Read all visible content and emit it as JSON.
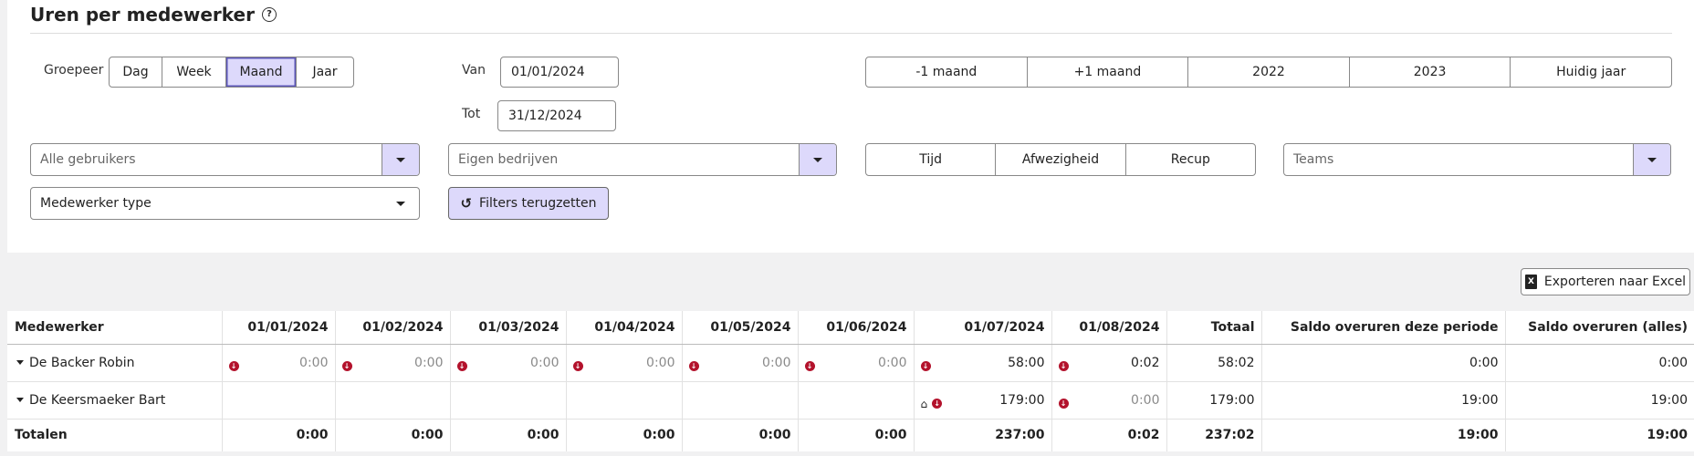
{
  "header": {
    "title": "Uren per medewerker"
  },
  "grouping": {
    "label": "Groepeer",
    "options": [
      "Dag",
      "Week",
      "Maand",
      "Jaar"
    ],
    "selected": "Maand"
  },
  "date_range": {
    "from_label": "Van",
    "from_value": "01/01/2024",
    "to_label": "Tot",
    "to_value": "31/12/2024"
  },
  "quick_periods": [
    "-1 maand",
    "+1 maand",
    "2022",
    "2023",
    "Huidig jaar"
  ],
  "filters": {
    "users_placeholder": "Alle gebruikers",
    "companies_placeholder": "Eigen bedrijven",
    "teams_placeholder": "Teams",
    "employee_type_value": "Medewerker type",
    "type_toggle": [
      "Tijd",
      "Afwezigheid",
      "Recup"
    ],
    "reset_label": "Filters terugzetten"
  },
  "export_label": "Exporteren naar Excel",
  "table": {
    "columns": [
      "Medewerker",
      "01/01/2024",
      "01/02/2024",
      "01/03/2024",
      "01/04/2024",
      "01/05/2024",
      "01/06/2024",
      "01/07/2024",
      "01/08/2024",
      "Totaal",
      "Saldo overuren deze periode",
      "Saldo overuren (alles)"
    ],
    "rows": [
      {
        "name": "De Backer Robin",
        "months": [
          "0:00",
          "0:00",
          "0:00",
          "0:00",
          "0:00",
          "0:00",
          "58:00",
          "0:02"
        ],
        "month_icons": [
          [
            "down-arrow-icon"
          ],
          [
            "down-arrow-icon"
          ],
          [
            "down-arrow-icon"
          ],
          [
            "down-arrow-icon"
          ],
          [
            "down-arrow-icon"
          ],
          [
            "down-arrow-icon"
          ],
          [
            "down-arrow-icon"
          ],
          [
            "down-arrow-icon"
          ]
        ],
        "month_muted": [
          true,
          true,
          true,
          true,
          true,
          true,
          false,
          false
        ],
        "total": "58:02",
        "saldo_period": "0:00",
        "saldo_all": "0:00",
        "saldo_muted": true
      },
      {
        "name": "De Keersmaeker Bart",
        "months": [
          "",
          "",
          "",
          "",
          "",
          "",
          "179:00",
          "0:00"
        ],
        "month_icons": [
          [],
          [],
          [],
          [],
          [],
          [],
          [
            "home-icon",
            "down-arrow-icon"
          ],
          [
            "down-arrow-icon"
          ]
        ],
        "month_muted": [
          false,
          false,
          false,
          false,
          false,
          false,
          false,
          true
        ],
        "total": "179:00",
        "saldo_period": "19:00",
        "saldo_all": "19:00",
        "saldo_muted": false
      }
    ],
    "totals": {
      "label": "Totalen",
      "months": [
        "0:00",
        "0:00",
        "0:00",
        "0:00",
        "0:00",
        "0:00",
        "237:00",
        "0:02"
      ],
      "total": "237:02",
      "saldo_period": "19:00",
      "saldo_all": "19:00"
    }
  },
  "colors": {
    "accent_bg": "#ddd9fb",
    "accent_border": "#5c56b8",
    "icon_red": "#b3122c"
  }
}
